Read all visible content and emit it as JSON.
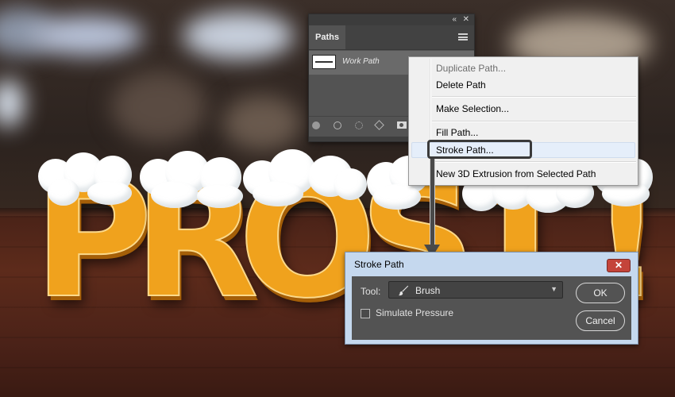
{
  "paths_panel": {
    "tab_label": "Paths",
    "work_path_name": "Work Path"
  },
  "context_menu": {
    "items": [
      {
        "label": "Duplicate Path...",
        "enabled": false
      },
      {
        "label": "Delete Path",
        "enabled": true
      },
      {
        "label": "Make Selection...",
        "enabled": true
      },
      {
        "label": "Fill Path...",
        "enabled": true
      },
      {
        "label": "Stroke Path...",
        "enabled": true,
        "highlighted": true
      },
      {
        "label": "New 3D Extrusion from Selected Path",
        "enabled": true
      }
    ]
  },
  "stroke_dialog": {
    "title": "Stroke Path",
    "tool_label": "Tool:",
    "tool_value": "Brush",
    "simulate_pressure_label": "Simulate Pressure",
    "simulate_pressure_checked": false,
    "ok_label": "OK",
    "cancel_label": "Cancel"
  },
  "artwork": {
    "letters": [
      "P",
      "R",
      "O",
      "S",
      "T",
      "!"
    ],
    "letter_color": "#f0a21d",
    "foam_color": "#ffffff"
  },
  "colors": {
    "menu_highlight": "#e5eefa",
    "panel_bg": "#535353",
    "dialog_frame": "#c5d8ee",
    "close_button": "#c4443a"
  }
}
